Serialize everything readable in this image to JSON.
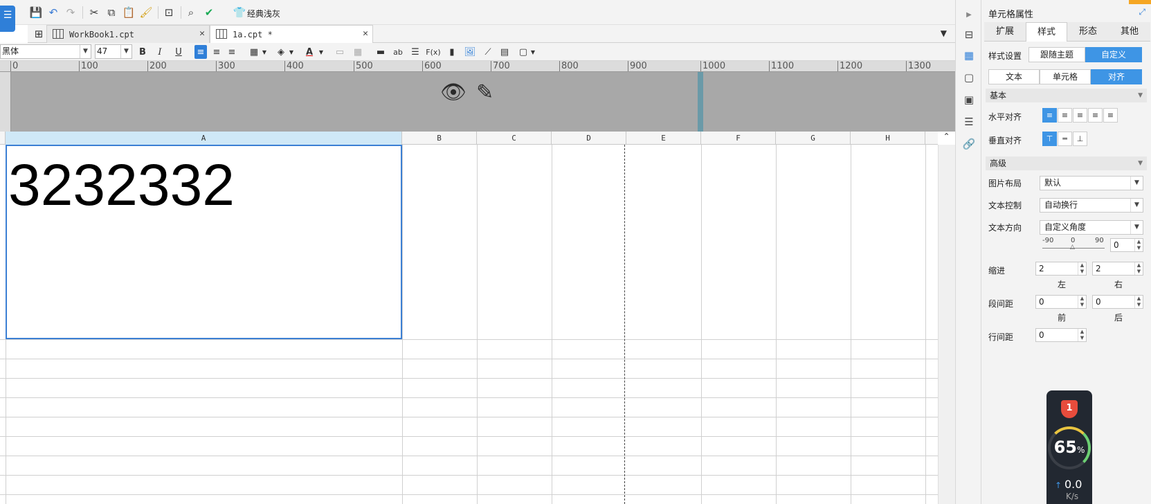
{
  "toolbar": {
    "theme_label": "经典浅灰"
  },
  "tabs": [
    {
      "label": "WorkBook1.cpt",
      "close": "✕"
    },
    {
      "label": "1a.cpt *",
      "close": "✕"
    }
  ],
  "format": {
    "font_family": "黑体",
    "font_size": "47",
    "bold": "B",
    "italic": "I",
    "underline": "U",
    "text_tool": "ab",
    "formula": "F(x)"
  },
  "ruler": {
    "ticks": [
      "0",
      "100",
      "200",
      "300",
      "400",
      "500",
      "600",
      "700",
      "800",
      "900",
      "1000",
      "1100",
      "1200",
      "1300"
    ]
  },
  "columns": [
    "A",
    "B",
    "C",
    "D",
    "E",
    "F",
    "G",
    "H"
  ],
  "cell_a1": {
    "value": "3232332"
  },
  "panel": {
    "title": "单元格属性",
    "tabs": [
      "扩展",
      "样式",
      "形态",
      "其他"
    ],
    "style_setting_label": "样式设置",
    "style_options": [
      "跟随主题",
      "自定义"
    ],
    "sub_tabs": [
      "文本",
      "单元格",
      "对齐"
    ],
    "basic_section": "基本",
    "h_align_label": "水平对齐",
    "v_align_label": "垂直对齐",
    "advanced_section": "高级",
    "image_layout_label": "图片布局",
    "image_layout_value": "默认",
    "text_control_label": "文本控制",
    "text_control_value": "自动换行",
    "text_direction_label": "文本方向",
    "text_direction_value": "自定义角度",
    "angle_min": "-90",
    "angle_mid": "0",
    "angle_max": "90",
    "angle_value": "0",
    "indent_label": "缩进",
    "indent_left": "2",
    "indent_right": "2",
    "left_label": "左",
    "right_label": "右",
    "para_spacing_label": "段间距",
    "para_before": "0",
    "para_after": "0",
    "before_label": "前",
    "after_label": "后",
    "line_spacing_label": "行间距",
    "line_spacing_value": "0"
  },
  "speed_widget": {
    "badge": "1",
    "percent": "65",
    "percent_sign": "%",
    "speed": "0.0",
    "unit": "K/s"
  },
  "colors": {
    "accent": "#3e95e5",
    "selection_border": "#3b7fd4",
    "header_band": "#a8a8a8"
  }
}
